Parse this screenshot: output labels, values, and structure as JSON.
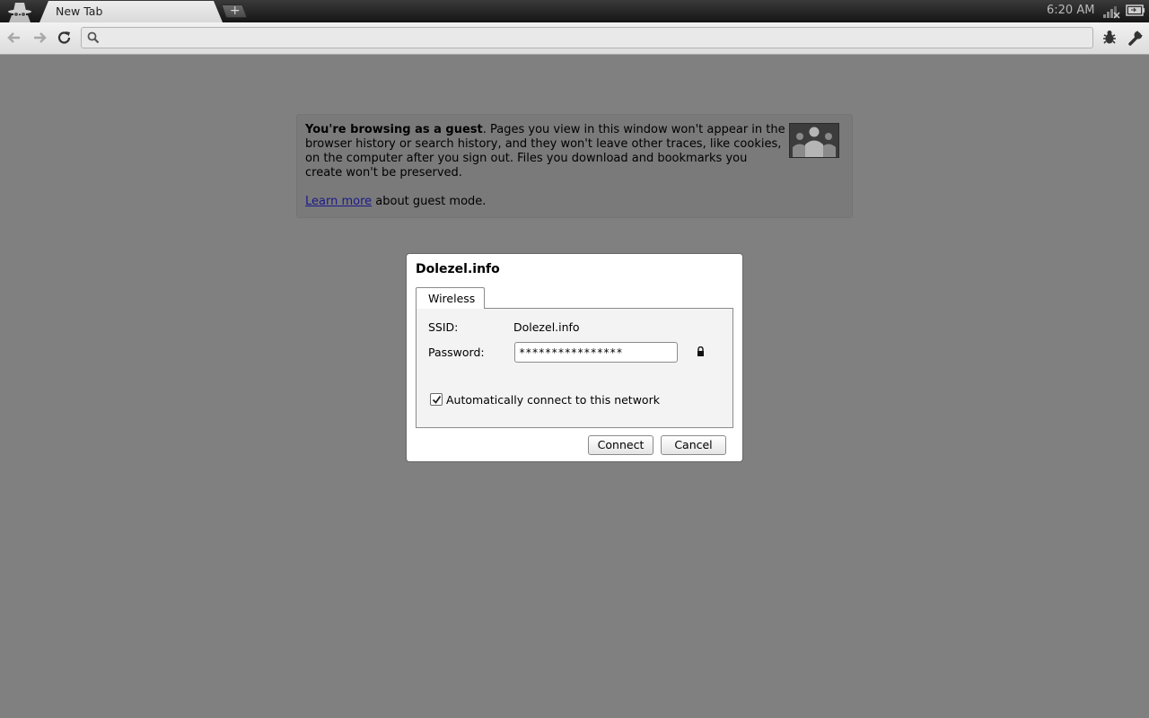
{
  "tabstrip": {
    "tab_title": "New Tab",
    "new_tab_label": "+",
    "clock": "6:20 AM"
  },
  "toolbar": {
    "omnibox_value": ""
  },
  "guest_notice": {
    "bold_text": "You're browsing as a guest",
    "body_text": ". Pages you view in this window won't appear in the browser history or search history, and they won't leave other traces, like cookies, on the computer after you sign out. Files you download and bookmarks you create won't be preserved.",
    "learn_more_link": "Learn more",
    "learn_more_suffix": " about guest mode."
  },
  "dialog": {
    "title": "Dolezel.info",
    "tab_label": "Wireless",
    "ssid_label": "SSID:",
    "ssid_value": "Dolezel.info",
    "password_label": "Password:",
    "password_value": "****************",
    "auto_connect_label": "Automatically connect to this network",
    "auto_connect_checked": true,
    "connect_label": "Connect",
    "cancel_label": "Cancel"
  },
  "icons": {
    "incognito": "incognito-icon",
    "network": "wifi-signal-icon",
    "battery": "battery-icon",
    "back": "back-arrow-icon",
    "forward": "forward-arrow-icon",
    "reload": "reload-icon",
    "search": "search-icon",
    "bug": "bug-icon",
    "wrench": "wrench-icon",
    "guest": "guest-people-icon",
    "lock": "lock-icon"
  },
  "colors": {
    "page_background": "#808080",
    "dialog_background": "#ffffff",
    "link": "#1a1a8a"
  }
}
